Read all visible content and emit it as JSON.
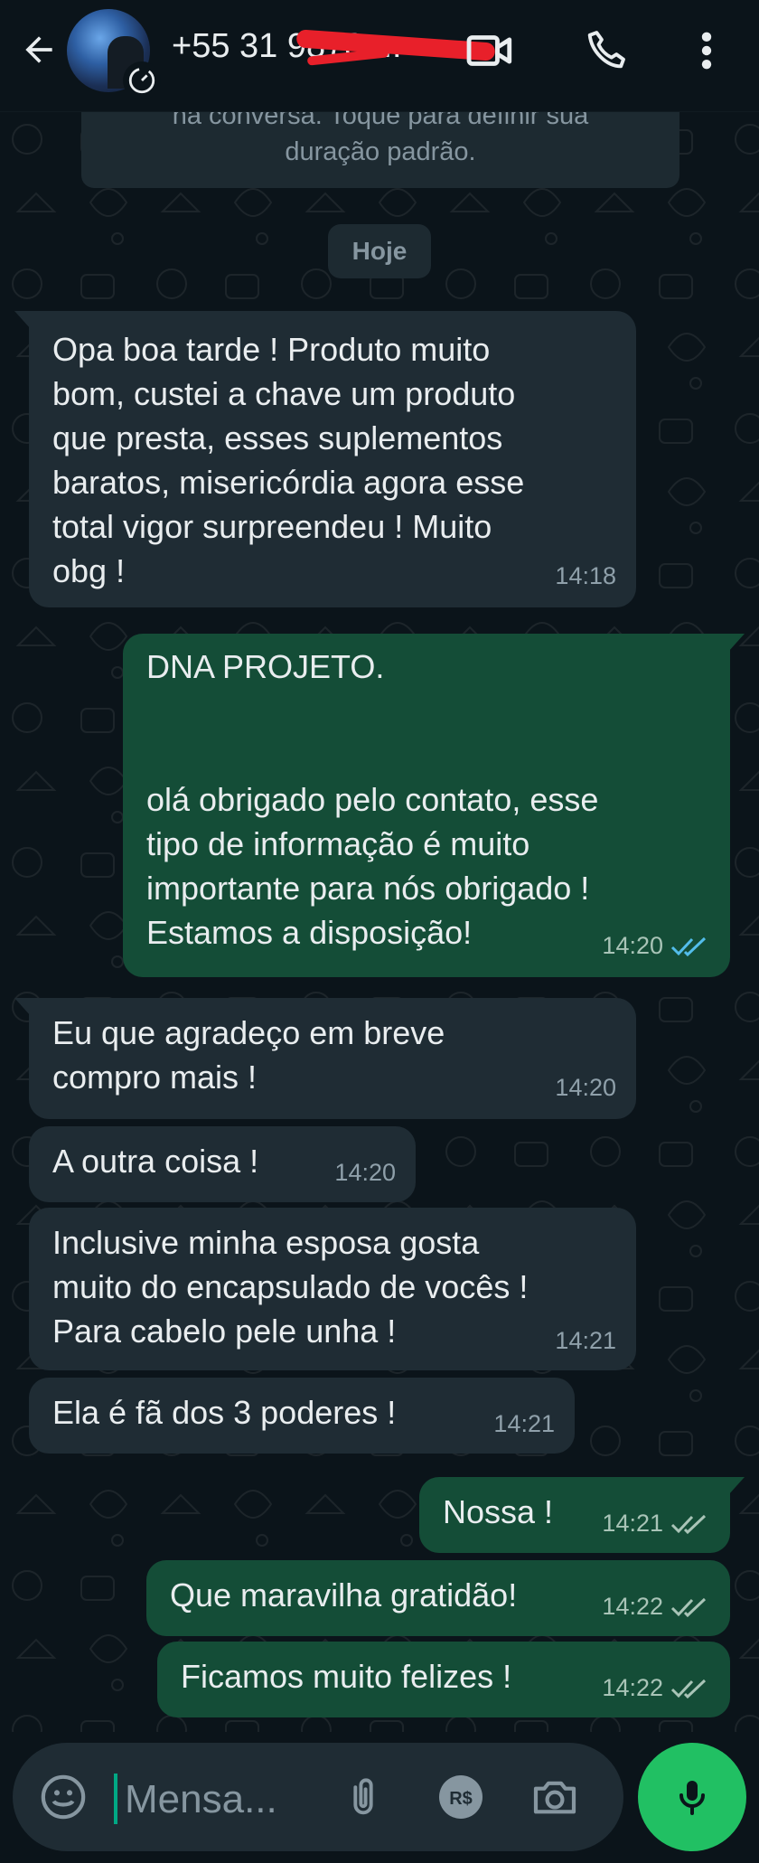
{
  "header": {
    "contact_name": "+55 31 9878 ...",
    "back_icon": "arrow-left-icon",
    "video_icon": "video-call-icon",
    "call_icon": "phone-icon",
    "menu_icon": "more-vert-icon",
    "badge_icon": "disappearing-timer-icon"
  },
  "system_note": {
    "line1": "na conversa. Toque para definir sua",
    "line2": "duração padrão."
  },
  "day_label": "Hoje",
  "messages": [
    {
      "dir": "in",
      "text": "Opa boa tarde ! Produto muito\nbom, custei a chave um produto\nque presta, esses suplementos\nbaratos, misericórdia  agora esse\ntotal vigor surpreendeu ! Muito\nobg !",
      "time": "14:18"
    },
    {
      "dir": "out",
      "text": "DNA PROJETO.\n\n\nolá obrigado pelo contato, esse\ntipo de informação é muito\nimportante para nós obrigado !\nEstamos a disposição!",
      "time": "14:20",
      "status": "read"
    },
    {
      "dir": "in",
      "text": "Eu que agradeço em breve\ncompro mais !",
      "time": "14:20"
    },
    {
      "dir": "in",
      "text": "A outra coisa !",
      "time": "14:20"
    },
    {
      "dir": "in",
      "text": "Inclusive minha esposa gosta\nmuito do encapsulado de vocês !\nPara cabelo pele unha !",
      "time": "14:21"
    },
    {
      "dir": "in",
      "text": "Ela é fã  dos 3 poderes !",
      "time": "14:21"
    },
    {
      "dir": "out",
      "text": "Nossa !",
      "time": "14:21",
      "status": "delivered"
    },
    {
      "dir": "out",
      "text": "Que maravilha gratidão!",
      "time": "14:22",
      "status": "delivered"
    },
    {
      "dir": "out",
      "text": "Ficamos muito felizes !",
      "time": "14:22",
      "status": "delivered"
    }
  ],
  "composer": {
    "placeholder": "Mensa...",
    "emoji_icon": "emoji-icon",
    "attach_icon": "paperclip-icon",
    "payment_icon": "payment-brl-icon",
    "payment_label": "R$",
    "camera_icon": "camera-icon",
    "mic_icon": "microphone-icon"
  },
  "colors": {
    "background": "#0b141a",
    "incoming_bubble": "#1f2c34",
    "outgoing_bubble": "#144d37",
    "read_check": "#53bdeb",
    "mic_button": "#21c063"
  }
}
